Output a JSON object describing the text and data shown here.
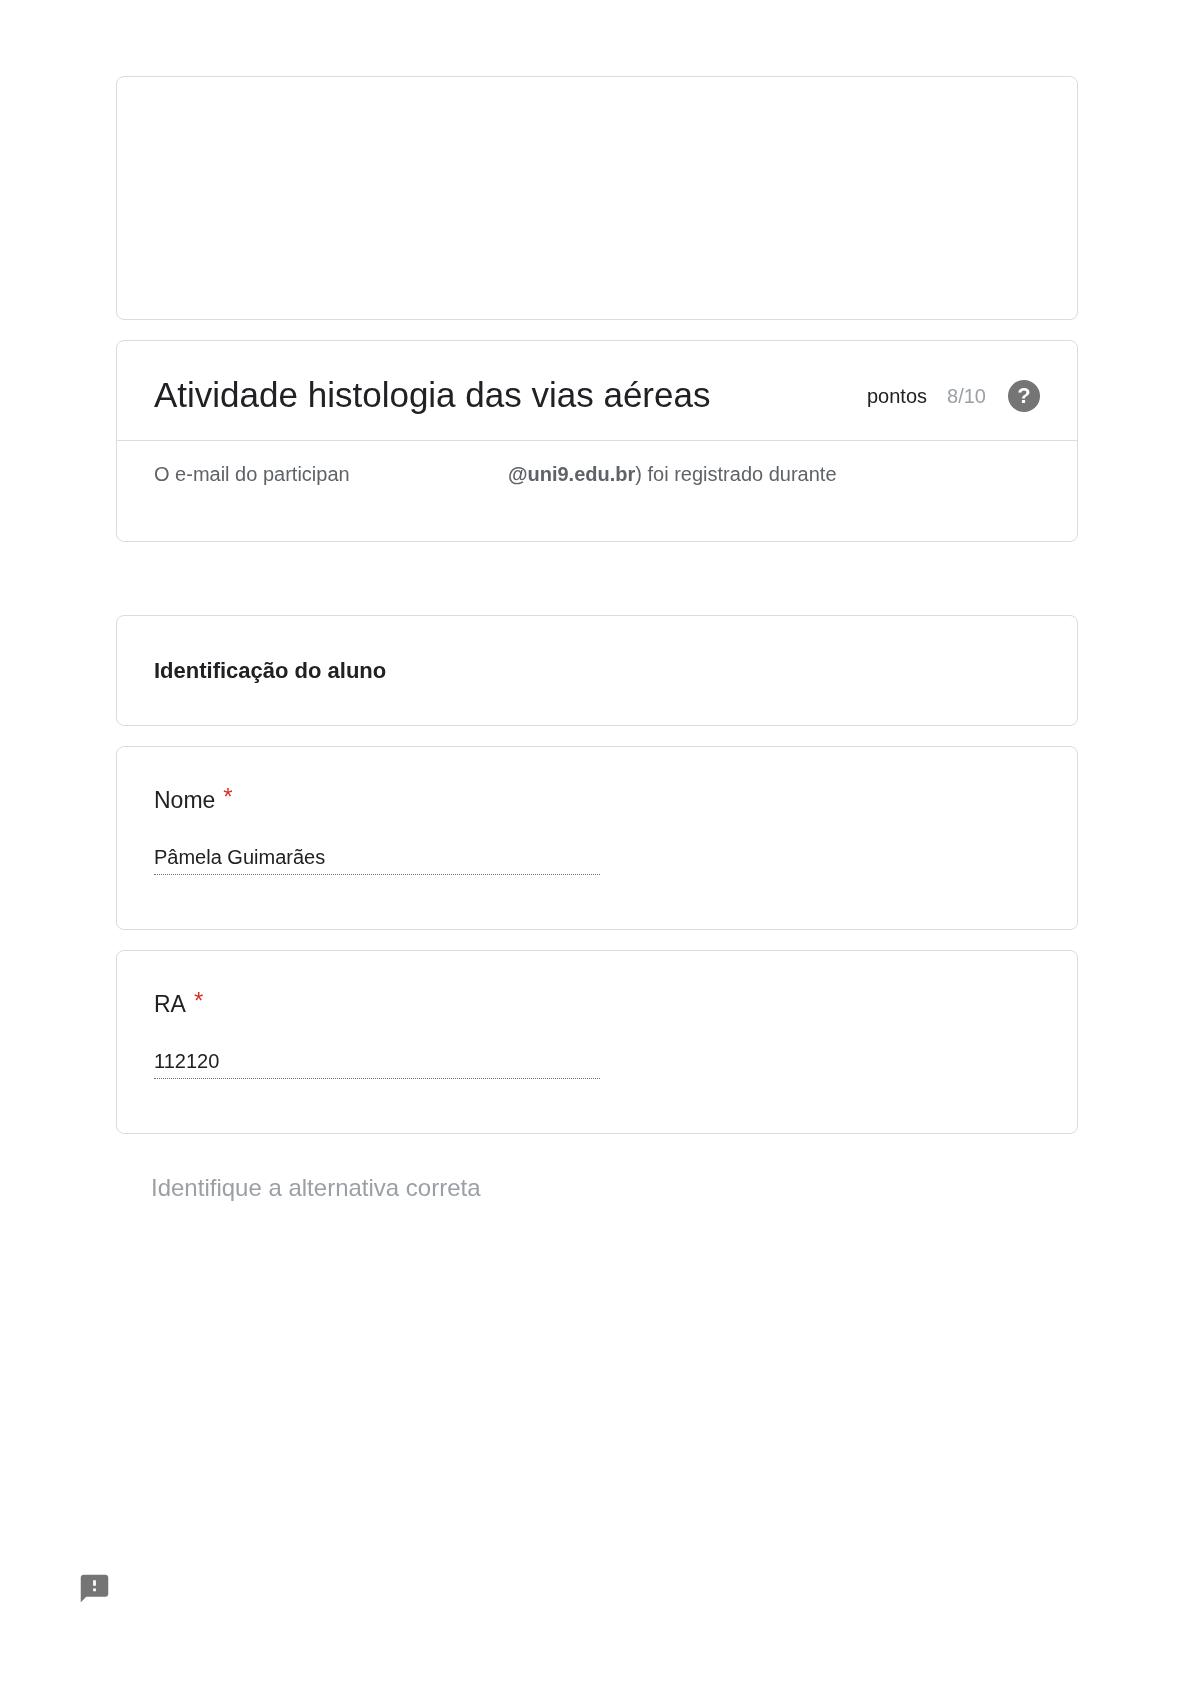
{
  "header": {
    "title": "Atividade histologia das vias aéreas",
    "points_label": "pontos",
    "score": "8/10",
    "help_icon": "?",
    "email_notice": [
      "O e-mail do participan",
      "**@uni9.edu.br**) foi registrado durante"
    ]
  },
  "section": {
    "title": "Identificação do aluno"
  },
  "questions": [
    {
      "label": "Nome",
      "required_mark": "*",
      "value": "Pâmela Guimarães"
    },
    {
      "label": "RA",
      "required_mark": "*",
      "value": "112120"
    }
  ],
  "next_title": "Identifique a alternativa correta"
}
